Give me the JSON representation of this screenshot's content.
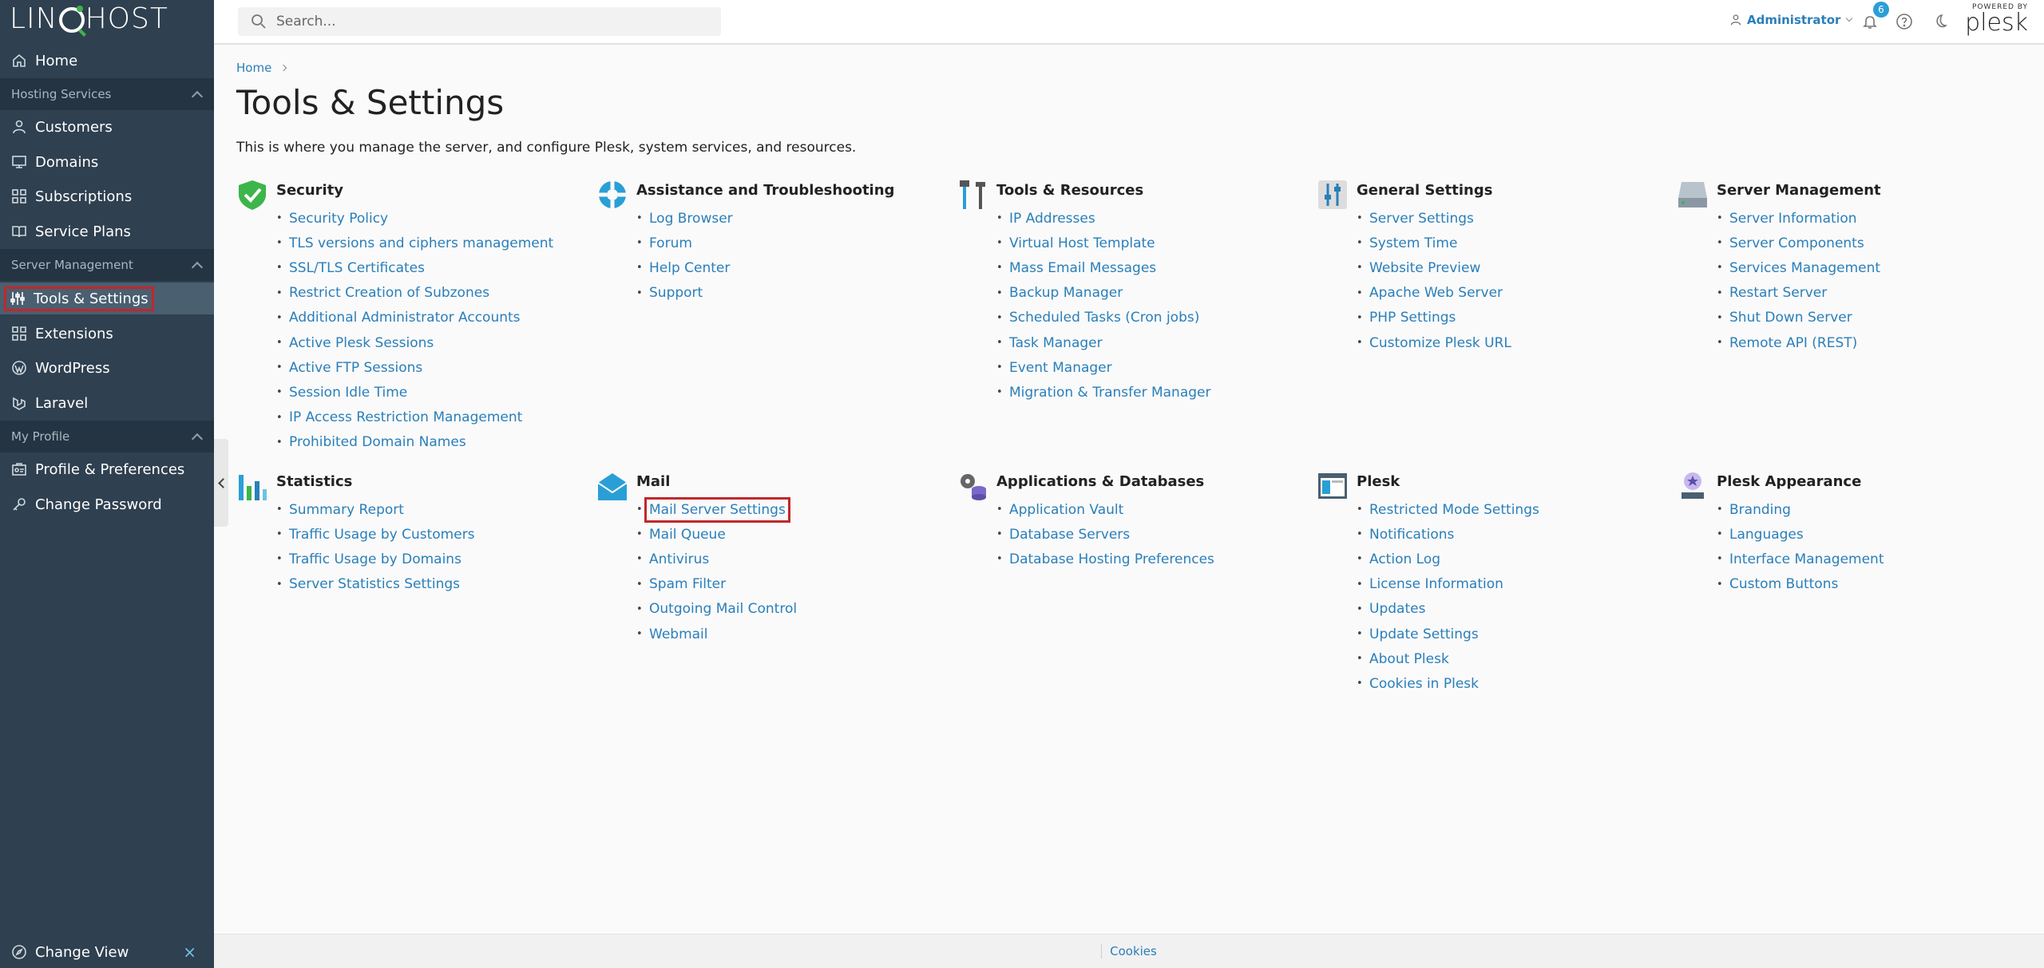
{
  "brand": {
    "logo_left": "LIN",
    "logo_right": "HOST"
  },
  "sidebar": {
    "home": "Home",
    "sections": [
      {
        "title": "Hosting Services",
        "items": [
          "Customers",
          "Domains",
          "Subscriptions",
          "Service Plans"
        ]
      },
      {
        "title": "Server Management",
        "items": [
          "Tools & Settings",
          "Extensions",
          "WordPress",
          "Laravel"
        ]
      },
      {
        "title": "My Profile",
        "items": [
          "Profile & Preferences",
          "Change Password"
        ]
      }
    ],
    "change_view": "Change View"
  },
  "topbar": {
    "search_placeholder": "Search...",
    "user": "Administrator",
    "notification_count": "6",
    "powered_by": "POWERED BY",
    "plesk": "plesk"
  },
  "breadcrumb": {
    "home": "Home"
  },
  "page": {
    "title": "Tools & Settings",
    "description": "This is where you manage the server, and configure Plesk, system services, and resources."
  },
  "groups": [
    {
      "title": "Security",
      "icon": "shield-icon",
      "items": [
        "Security Policy",
        "TLS versions and ciphers management",
        "SSL/TLS Certificates",
        "Restrict Creation of Subzones",
        "Additional Administrator Accounts",
        "Active Plesk Sessions",
        "Active FTP Sessions",
        "Session Idle Time",
        "IP Access Restriction Management",
        "Prohibited Domain Names"
      ]
    },
    {
      "title": "Assistance and Troubleshooting",
      "icon": "lifebuoy-icon",
      "items": [
        "Log Browser",
        "Forum",
        "Help Center",
        "Support"
      ]
    },
    {
      "title": "Tools & Resources",
      "icon": "tools-icon",
      "items": [
        "IP Addresses",
        "Virtual Host Template",
        "Mass Email Messages",
        "Backup Manager",
        "Scheduled Tasks (Cron jobs)",
        "Task Manager",
        "Event Manager",
        "Migration & Transfer Manager"
      ]
    },
    {
      "title": "General Settings",
      "icon": "sliders-icon",
      "items": [
        "Server Settings",
        "System Time",
        "Website Preview",
        "Apache Web Server",
        "PHP Settings",
        "Customize Plesk URL"
      ]
    },
    {
      "title": "Server Management",
      "icon": "server-icon",
      "items": [
        "Server Information",
        "Server Components",
        "Services Management",
        "Restart Server",
        "Shut Down Server",
        "Remote API (REST)"
      ]
    },
    {
      "title": "Statistics",
      "icon": "bar-chart-icon",
      "items": [
        "Summary Report",
        "Traffic Usage by Customers",
        "Traffic Usage by Domains",
        "Server Statistics Settings"
      ]
    },
    {
      "title": "Mail",
      "icon": "mail-icon",
      "items": [
        "Mail Server Settings",
        "Mail Queue",
        "Antivirus",
        "Spam Filter",
        "Outgoing Mail Control",
        "Webmail"
      ]
    },
    {
      "title": "Applications & Databases",
      "icon": "gears-database-icon",
      "items": [
        "Application Vault",
        "Database Servers",
        "Database Hosting Preferences"
      ]
    },
    {
      "title": "Plesk",
      "icon": "plesk-window-icon",
      "items": [
        "Restricted Mode Settings",
        "Notifications",
        "Action Log",
        "License Information",
        "Updates",
        "Update Settings",
        "About Plesk",
        "Cookies in Plesk"
      ]
    },
    {
      "title": "Plesk Appearance",
      "icon": "appearance-icon",
      "items": [
        "Branding",
        "Languages",
        "Interface Management",
        "Custom Buttons"
      ]
    }
  ],
  "footer": {
    "cookies": "Cookies"
  },
  "colors": {
    "sidebar": "#2f4050",
    "link": "#2a7fba",
    "highlight": "#c0282c"
  }
}
